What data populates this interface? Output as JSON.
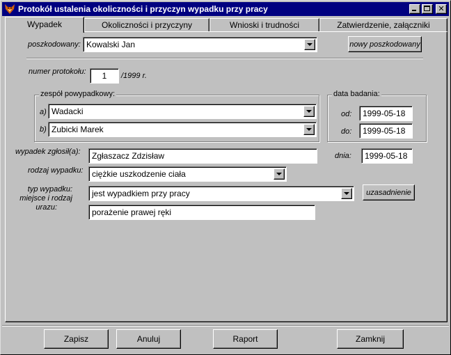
{
  "window": {
    "title": "Protokół ustalenia okoliczności i przyczyn wypadku przy pracy",
    "icon": "fox-app-icon"
  },
  "tabs": [
    {
      "label": "Wypadek",
      "active": true
    },
    {
      "label": "Okoliczności i przyczyny",
      "active": false
    },
    {
      "label": "Wnioski i trudności",
      "active": false
    },
    {
      "label": "Zatwierdzenie, załączniki",
      "active": false
    }
  ],
  "form": {
    "poszkodowany_label": "poszkodowany:",
    "poszkodowany_value": "Kowalski Jan",
    "new_injured_button": "nowy poszkodowany",
    "protocol_label": "numer protokołu:",
    "protocol_value": "1",
    "protocol_suffix": "/1999 r.",
    "team_group_title": "zespół powypadkowy:",
    "team_a_label": "a)",
    "team_a_value": "Wadacki",
    "team_b_label": "b)",
    "team_b_value": "Zubicki Marek",
    "date_group_title": "data badania:",
    "date_from_label": "od:",
    "date_from_value": "1999-05-18",
    "date_to_label": "do:",
    "date_to_value": "1999-05-18",
    "reported_label": "wypadek zgłosił(a):",
    "reported_value": "Zgłaszacz Zdzisław",
    "day_label": "dnia:",
    "day_value": "1999-05-18",
    "accident_type_label": "rodzaj wypadku:",
    "accident_type_value": "ciężkie uszkodzenie ciała",
    "accident_kind_label": "typ wypadku:",
    "accident_kind_value": "jest wypadkiem przy pracy",
    "justification_button": "uzasadnienie",
    "injury_label_line1": "miejsce i rodzaj",
    "injury_label_line2": "urazu:",
    "injury_value": "porażenie prawej ręki"
  },
  "buttons": {
    "save": "Zapisz",
    "cancel": "Anuluj",
    "report": "Raport",
    "close": "Zamknij"
  }
}
